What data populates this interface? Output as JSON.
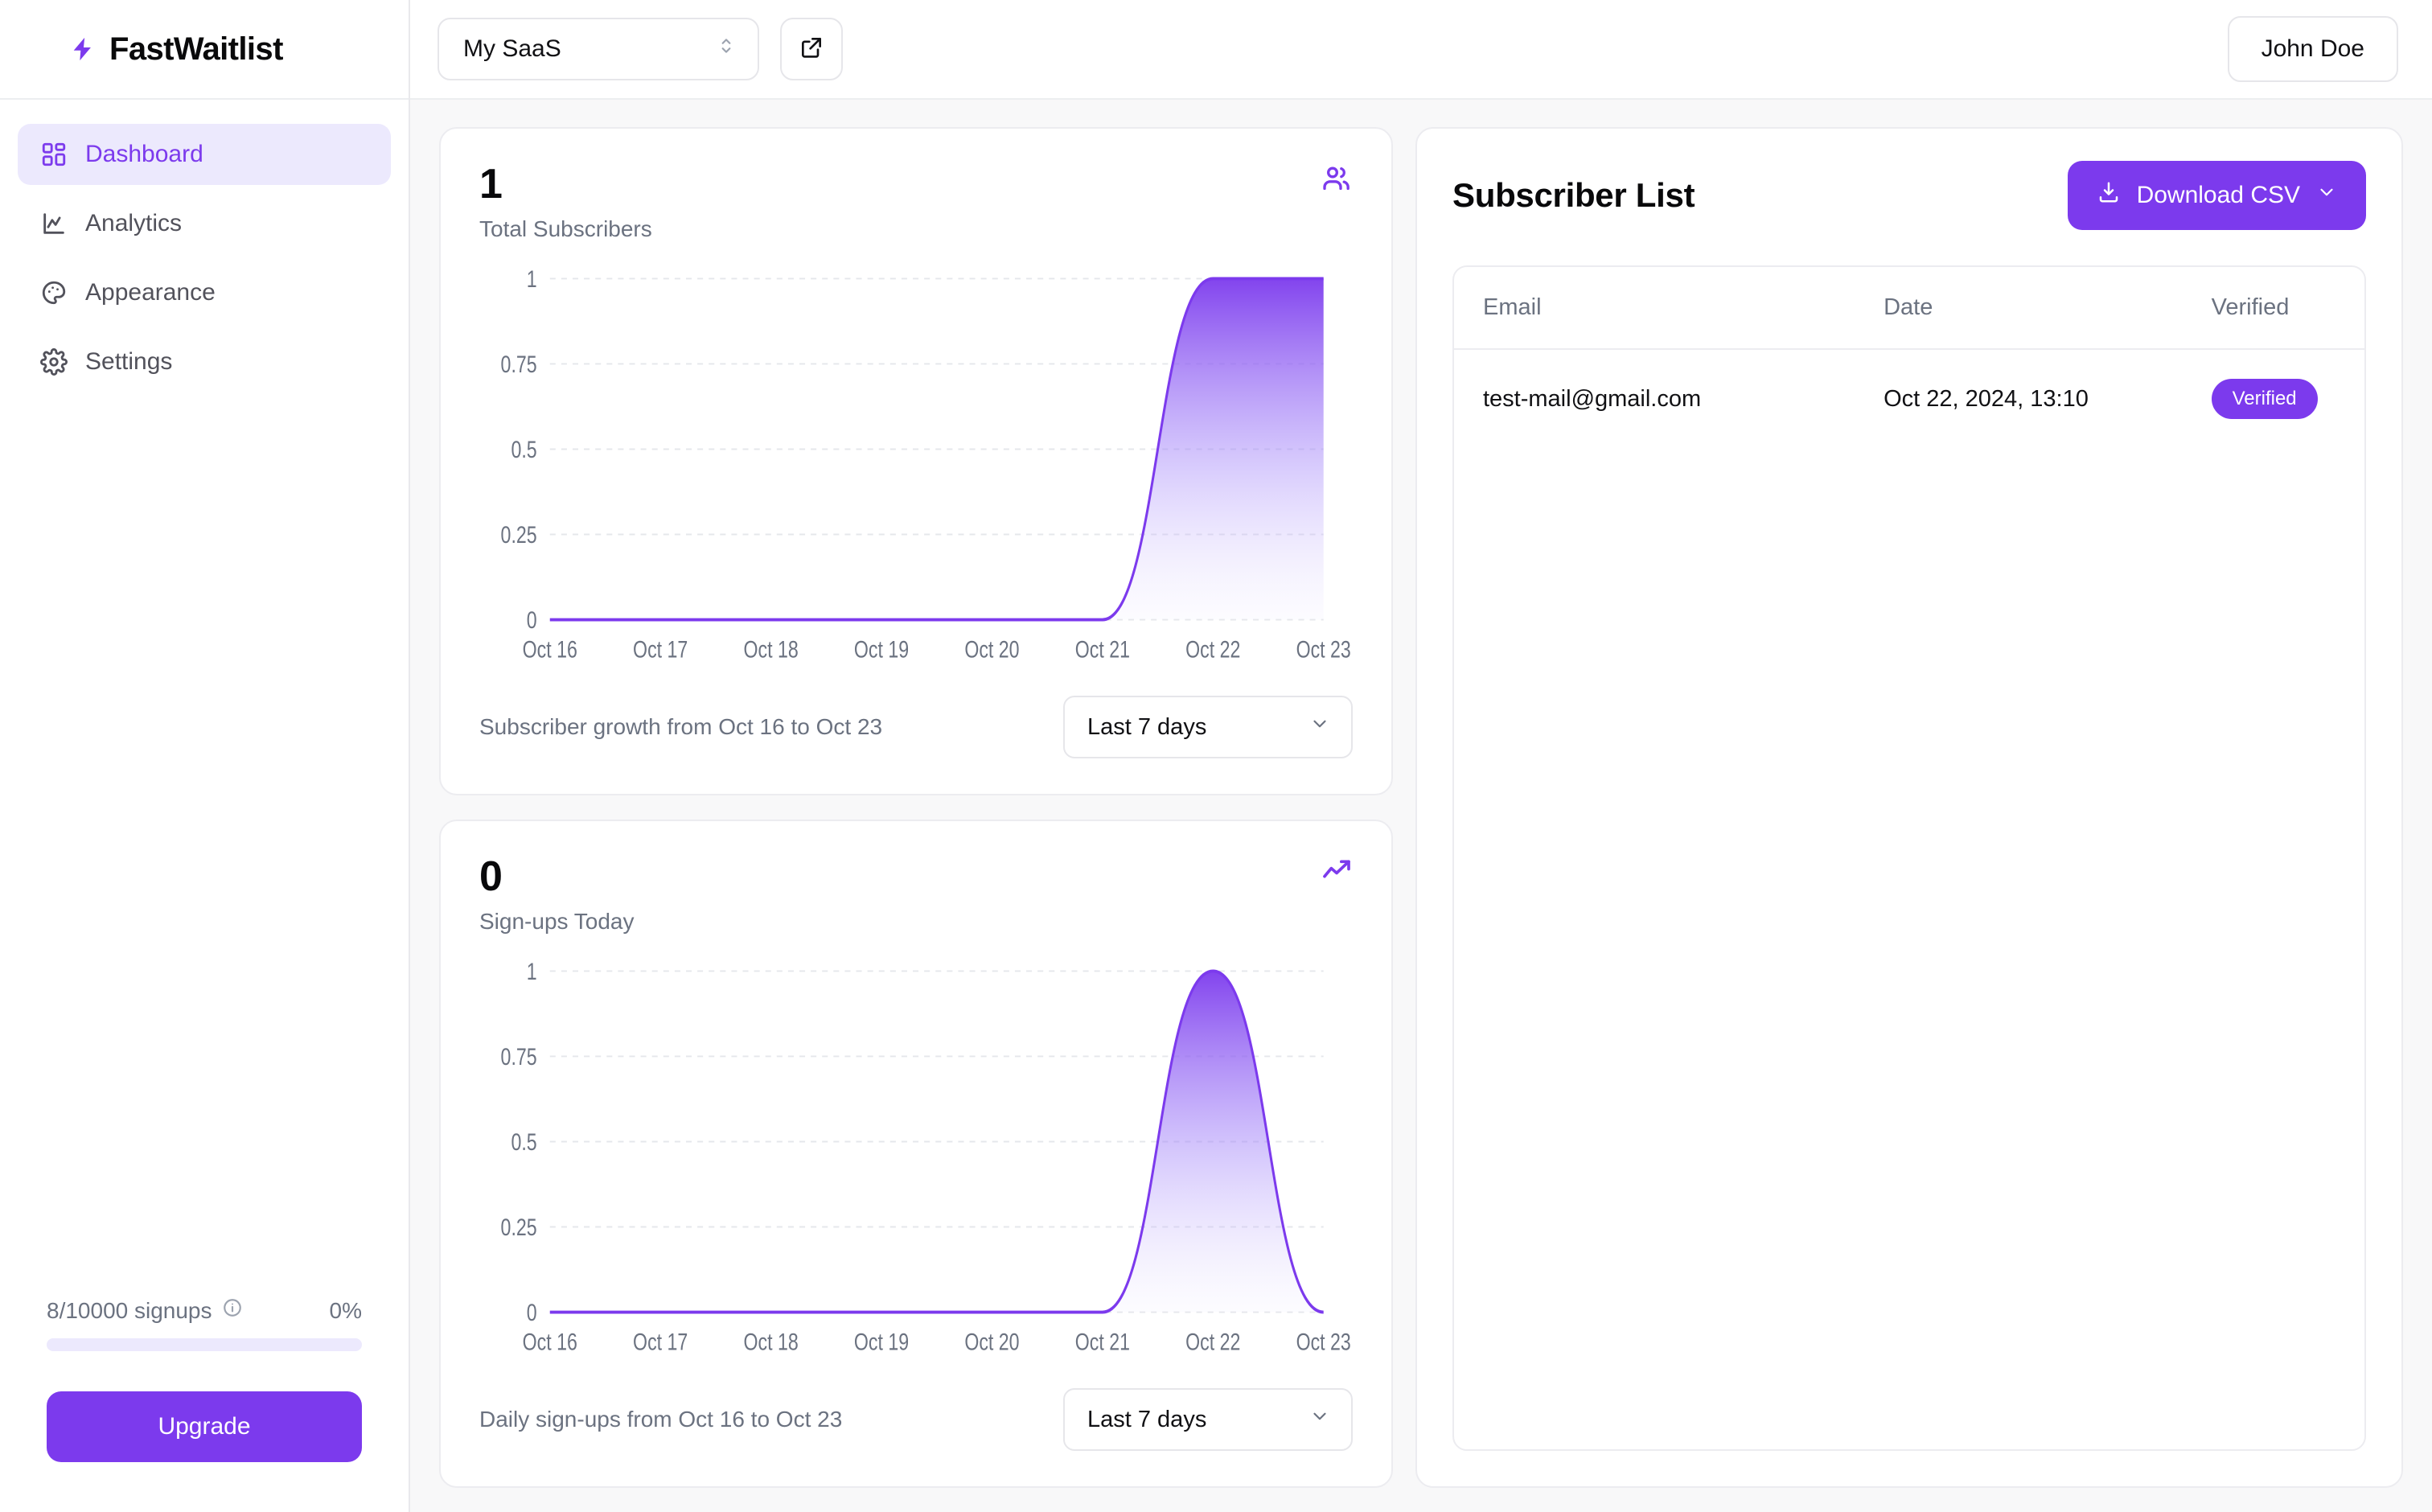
{
  "brand": {
    "name": "FastWaitlist",
    "icon": "lightning-bolt-icon",
    "accent": "#7c3aed"
  },
  "sidebar": {
    "items": [
      {
        "label": "Dashboard",
        "icon": "grid-layout-icon",
        "active": true
      },
      {
        "label": "Analytics",
        "icon": "chart-line-icon",
        "active": false
      },
      {
        "label": "Appearance",
        "icon": "palette-icon",
        "active": false
      },
      {
        "label": "Settings",
        "icon": "gear-icon",
        "active": false
      }
    ],
    "quota": {
      "label": "8/10000 signups",
      "info_icon": "info-circle-icon",
      "percent_label": "0%",
      "percent_value": 0
    },
    "upgrade_label": "Upgrade"
  },
  "topbar": {
    "workspace": "My SaaS",
    "workspace_icon": "chevron-up-down-icon",
    "external_link_icon": "external-link-icon",
    "user": "John Doe"
  },
  "cards": [
    {
      "value": "1",
      "label": "Total Subscribers",
      "icon": "users-icon",
      "footer_text": "Subscriber growth from Oct 16 to Oct 23",
      "range": "Last 7 days",
      "range_icon": "chevron-down-icon"
    },
    {
      "value": "0",
      "label": "Sign-ups Today",
      "icon": "trending-up-icon",
      "footer_text": "Daily sign-ups from Oct 16 to Oct 23",
      "range": "Last 7 days",
      "range_icon": "chevron-down-icon"
    }
  ],
  "subscriber_list": {
    "title": "Subscriber List",
    "download_label": "Download CSV",
    "download_icon": "download-icon",
    "download_chevron": "chevron-down-icon",
    "columns": [
      "Email",
      "Date",
      "Verified"
    ],
    "rows": [
      {
        "email": "test-mail@gmail.com",
        "date": "Oct 22, 2024, 13:10",
        "verified": "Verified"
      }
    ]
  },
  "chart_data": [
    {
      "type": "area",
      "title": "Total Subscribers",
      "subtitle": "Subscriber growth from Oct 16 to Oct 23",
      "x": [
        "Oct 16",
        "Oct 17",
        "Oct 18",
        "Oct 19",
        "Oct 20",
        "Oct 21",
        "Oct 22",
        "Oct 23"
      ],
      "values": [
        0,
        0,
        0,
        0,
        0,
        0,
        1,
        1
      ],
      "ytick_labels": [
        "0",
        "0.25",
        "0.5",
        "0.75",
        "1"
      ],
      "ylim": [
        0,
        1
      ],
      "xlabel": "",
      "ylabel": "",
      "grid": true,
      "legend": "none",
      "line_color": "#7c3aed",
      "fill": "gradient purple to transparent"
    },
    {
      "type": "area",
      "title": "Sign-ups Today",
      "subtitle": "Daily sign-ups from Oct 16 to Oct 23",
      "x": [
        "Oct 16",
        "Oct 17",
        "Oct 18",
        "Oct 19",
        "Oct 20",
        "Oct 21",
        "Oct 22",
        "Oct 23"
      ],
      "values": [
        0,
        0,
        0,
        0,
        0,
        0,
        1,
        0
      ],
      "ytick_labels": [
        "0",
        "0.25",
        "0.5",
        "0.75",
        "1"
      ],
      "ylim": [
        0,
        1
      ],
      "xlabel": "",
      "ylabel": "",
      "grid": true,
      "legend": "none",
      "line_color": "#7c3aed",
      "fill": "gradient purple to transparent"
    }
  ]
}
